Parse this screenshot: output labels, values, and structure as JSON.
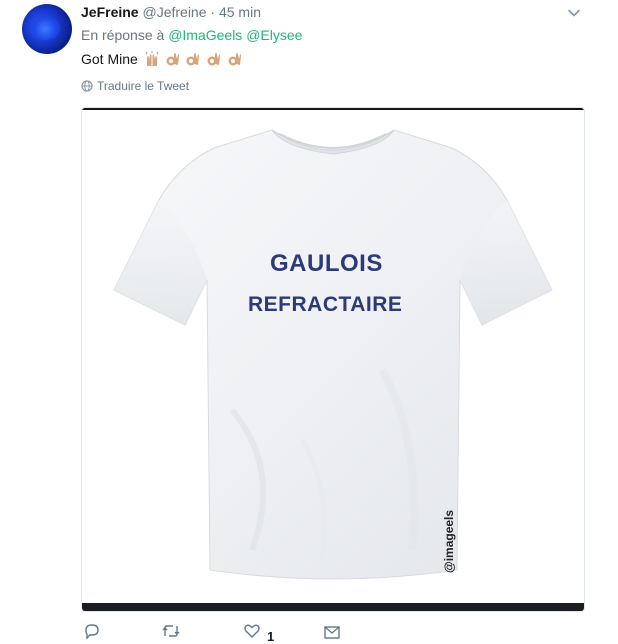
{
  "tweet": {
    "author_name": "JeFreine",
    "author_handle": "@Jefreine",
    "separator": "·",
    "time": "45 min",
    "reply_prefix": "En réponse à",
    "reply_mentions": [
      "@ImaGeels",
      "@Elysee"
    ],
    "text": "Got Mine",
    "emojis": [
      "raising-hands",
      "ok-hand",
      "ok-hand",
      "ok-hand",
      "ok-hand"
    ],
    "translate_label": "Traduire le Tweet",
    "likes_count": "1"
  },
  "media": {
    "line1": "GAULOIS",
    "line2": "REFRACTAIRE",
    "watermark": "@imageels"
  },
  "colors": {
    "mention": "#1fb87a",
    "muted": "#657786",
    "shirt_text": "#2c3a78"
  }
}
